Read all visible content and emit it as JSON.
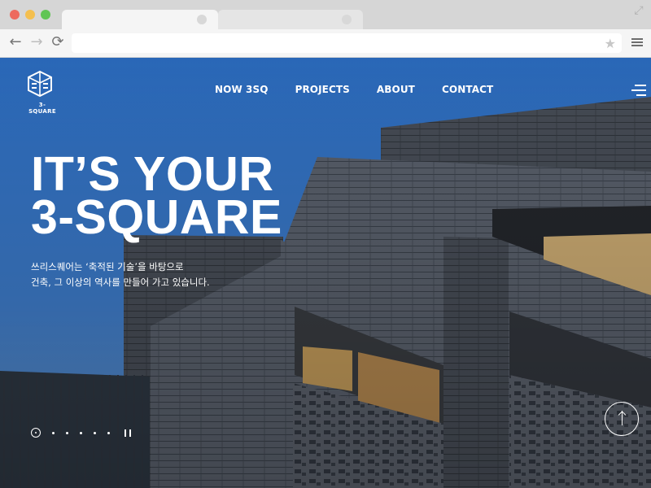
{
  "browser": {
    "window_controls": [
      "close",
      "minimize",
      "maximize"
    ],
    "tabs": [
      {
        "label": ""
      },
      {
        "label": ""
      }
    ],
    "url_bar": {
      "value": "",
      "placeholder": ""
    }
  },
  "site": {
    "logo_text": "3-SQUARE",
    "nav": [
      "NOW 3SQ",
      "PROJECTS",
      "ABOUT",
      "CONTACT"
    ],
    "hero": {
      "headline_line1": "IT’S YOUR",
      "headline_line2": "3-SQUARE",
      "subcopy_line1": "쓰리스퀘어는 ‘축적된 기술’을 바탕으로",
      "subcopy_line2": "건축, 그 이상의 역사를 만들어 가고 있습니다."
    },
    "slider": {
      "current": 1,
      "total": 7,
      "state": "playing"
    }
  },
  "colors": {
    "sky": "#2f72c9",
    "tab_bar": "#d6d6d6",
    "close": "#ed6a5e",
    "minimize": "#f4bf4f",
    "maximize": "#61c554"
  },
  "icons": {
    "back": "arrow-left-icon",
    "forward": "arrow-right-icon",
    "reload": "reload-icon",
    "bookmark": "star-icon",
    "browser_menu": "menu-icon",
    "fullscreen": "fullscreen-icon",
    "site_menu": "hamburger-icon",
    "scroll_top": "arrow-up-icon",
    "pause": "pause-icon"
  }
}
